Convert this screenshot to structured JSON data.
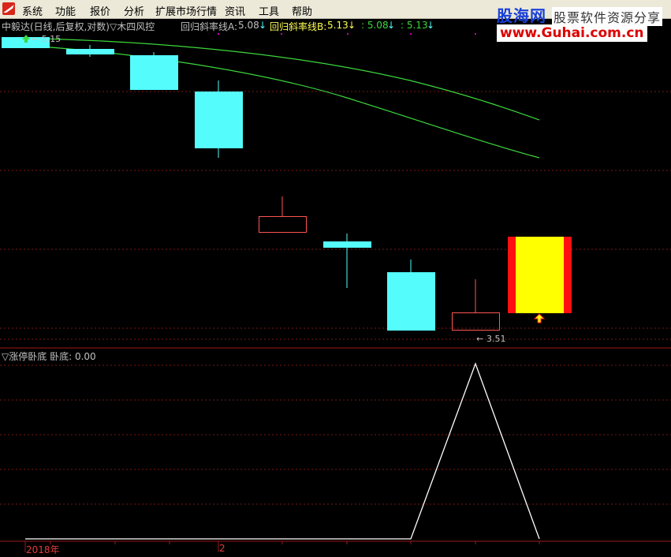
{
  "menu": {
    "items": [
      "系统",
      "功能",
      "报价",
      "分析",
      "扩展市场行情",
      "资讯",
      "工具",
      "帮助"
    ]
  },
  "brand": {
    "logo_text": "股海网",
    "tagline": "股票软件资源分享",
    "url": "www.Guhai.com.cn"
  },
  "main_panel": {
    "title": "中毅达(日线,后复权,对数)",
    "indicator_name": "▽木四风控",
    "line_a_label": "回归斜率线A:",
    "line_a_value": "5.08",
    "line_b_label": "回归斜率线B:",
    "line_b_value": "5.13",
    "extra_value_1": ": 5.08",
    "extra_value_2": ": 5.13",
    "high_label": "5.15",
    "low_label": "3.51"
  },
  "sub_panel": {
    "indicator_name": "▽涨停卧底",
    "field_label": "卧底:",
    "field_value": "0.00"
  },
  "date_axis": {
    "year_label": "2018年",
    "month_label": "2"
  },
  "colors": {
    "background": "#000000",
    "bear_candle": "#54fcfc",
    "bull_candle_outline": "#ff5454",
    "regression_line": "#3cd83c",
    "limit_up_fill": "#ffff00",
    "limit_up_border": "#ff1010",
    "grid": "#7a1818",
    "indicator_line": "#ffffff"
  },
  "chart_data": {
    "type": "candlestick",
    "candles": [
      {
        "direction": "down",
        "open": 5.15,
        "close": 5.08
      },
      {
        "direction": "down",
        "open": 5.07,
        "close": 5.03
      },
      {
        "direction": "down",
        "open": 5.01,
        "close": 4.72
      },
      {
        "direction": "down",
        "open": 4.66,
        "close": 4.18
      },
      {
        "direction": "up",
        "open": 3.96,
        "close": 4.05
      },
      {
        "direction": "down",
        "open": 3.89,
        "close": 3.86
      },
      {
        "direction": "down",
        "open": 3.72,
        "close": 3.51
      },
      {
        "direction": "up",
        "open": 3.51,
        "close": 3.57
      },
      {
        "direction": "up",
        "open": 3.61,
        "close": 3.9,
        "limit_up": true
      }
    ],
    "series": [
      {
        "name": "回归斜率线A",
        "last_value": 5.08
      },
      {
        "name": "回归斜率线B",
        "last_value": 5.13
      }
    ],
    "sub_indicator": {
      "name": "卧底",
      "values": [
        0,
        0,
        0,
        0,
        0,
        0,
        0,
        1,
        0
      ]
    }
  }
}
